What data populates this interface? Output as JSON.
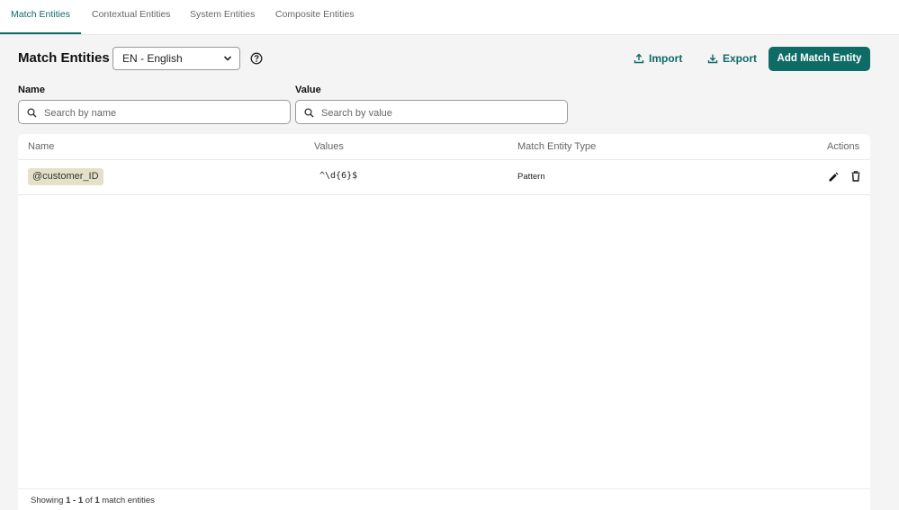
{
  "tabs": [
    {
      "label": "Match Entities",
      "active": true
    },
    {
      "label": "Contextual Entities",
      "active": false
    },
    {
      "label": "System Entities",
      "active": false
    },
    {
      "label": "Composite Entities",
      "active": false
    }
  ],
  "header": {
    "title": "Match Entities",
    "language": "EN - English",
    "import_label": "Import",
    "export_label": "Export",
    "add_label": "Add Match Entity"
  },
  "filters": {
    "name": {
      "label": "Name",
      "placeholder": "Search by name",
      "value": ""
    },
    "value": {
      "label": "Value",
      "placeholder": "Search by value",
      "value": ""
    }
  },
  "table": {
    "columns": [
      "Name",
      "Values",
      "Match Entity Type",
      "Actions"
    ],
    "rows": [
      {
        "name": "@customer_ID",
        "values": "^\\d{6}$",
        "type": "Pattern"
      }
    ]
  },
  "footer": {
    "prefix": "Showing",
    "range": "1 - 1",
    "of_label": "of",
    "total": "1",
    "suffix": "match entities"
  },
  "colors": {
    "accent": "#0f6b66",
    "chip_background": "#e5e1c8",
    "page_background": "#f4f4f4"
  },
  "icons": {
    "language_dropdown": "chevron-down-icon",
    "help": "help-circle-icon",
    "import": "upload-icon",
    "export": "download-icon",
    "search": "search-icon",
    "edit": "pencil-icon",
    "delete": "trash-icon"
  }
}
